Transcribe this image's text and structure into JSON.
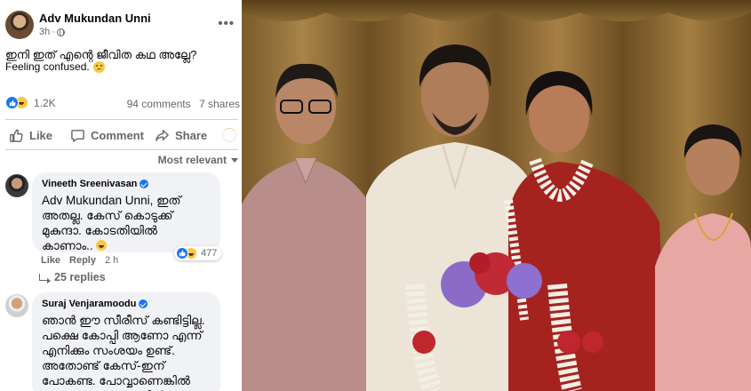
{
  "post": {
    "author": "Adv Mukundan Unni",
    "time": "3h",
    "text": "ഇനി ഇത് എന്റെ ജീവിത കഥ അല്ലേ?",
    "feeling": "Feeling confused.",
    "reaction_count": "1.2K",
    "comments": "94 comments",
    "shares": "7 shares"
  },
  "actions": {
    "like": "Like",
    "comment": "Comment",
    "share": "Share"
  },
  "sort_label": "Most relevant",
  "comments": [
    {
      "name": "Vineeth Sreenivasan",
      "mention": "Adv Mukundan Unni",
      "text": ", ഇത് അതല്ല. കേസ് കൊടുക്ക് മുകുന്ദാ. കോടതിയിൽ കാണാം..",
      "reactions": "477",
      "like": "Like",
      "reply": "Reply",
      "time": "2 h",
      "replies": "25 replies"
    },
    {
      "name": "Suraj Venjaramoodu",
      "text": "ഞാൻ ഈ സീരീസ് കണ്ടിട്ടില്ല. പക്ഷെ കോപ്പി ആണോ എന്ന് എനിക്കും സംശയം ഉണ്ട്. അതോണ്ട് കേസ്-ഇന് പോകണ്ട. പോവ്വാണെങ്കിൽ തന്നെ എന്നെ അതിൽ"
    }
  ],
  "colors": {
    "facebook_blue": "#1877f2",
    "secondary_text": "#65676b",
    "bubble_bg": "#f0f2f5"
  }
}
